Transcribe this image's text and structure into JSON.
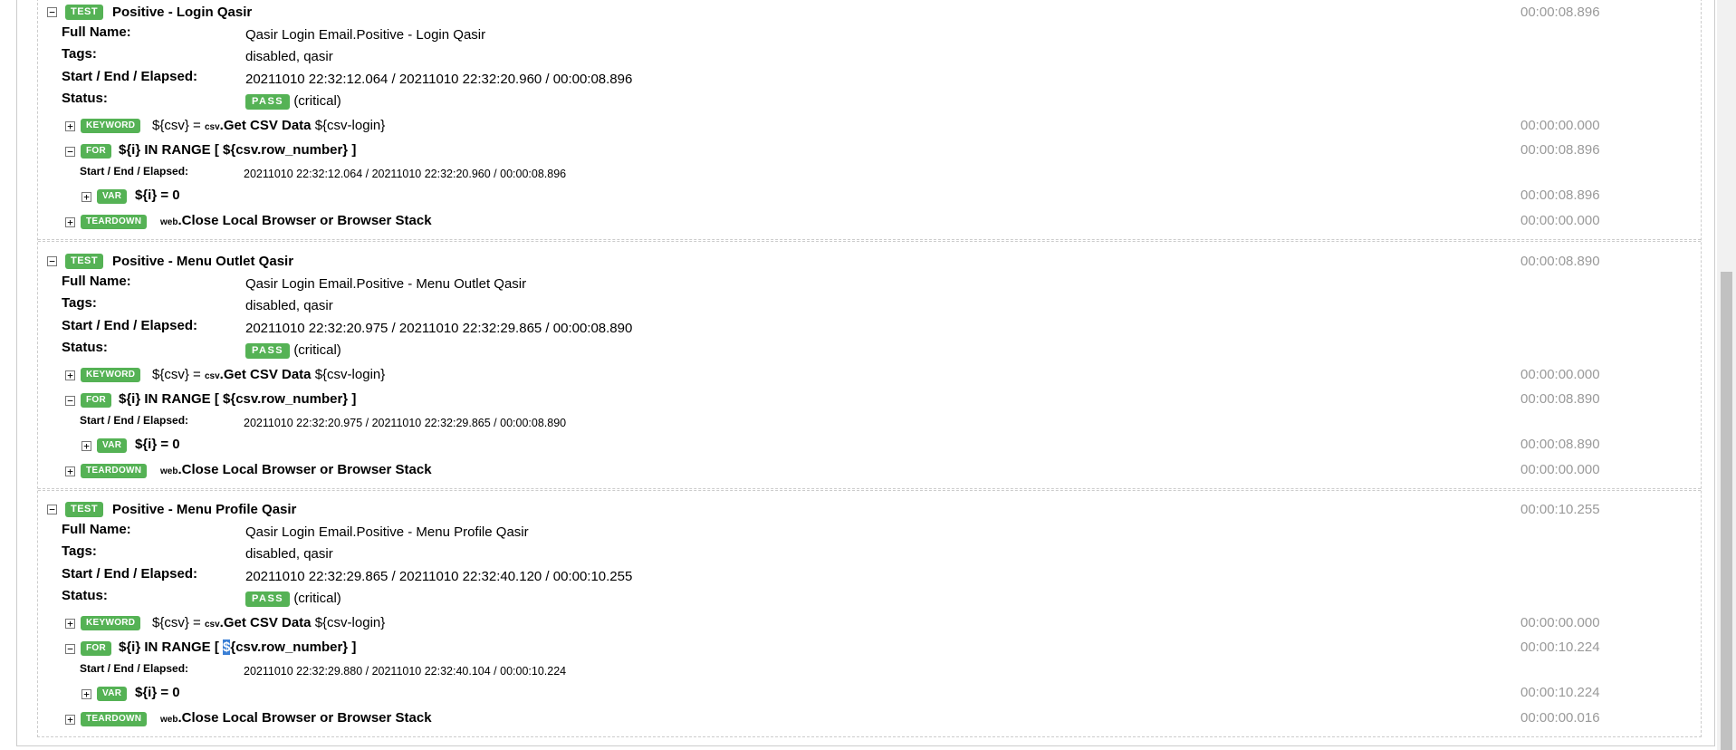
{
  "labels": {
    "test": "TEST",
    "keyword": "KEYWORD",
    "for": "FOR",
    "var": "VAR",
    "teardown": "TEARDOWN",
    "pass": "PASS",
    "critical": "(critical)",
    "full_name": "Full Name:",
    "tags": "Tags:",
    "start_end_elapsed": "Start / End / Elapsed:",
    "status": "Status:",
    "expand": "+",
    "collapse": "−"
  },
  "tests": [
    {
      "name": "Positive - Login Qasir",
      "elapsed": "00:00:08.896",
      "full_name": "Qasir Login Email.Positive - Login Qasir",
      "tags": "disabled, qasir",
      "times": "20211010 22:32:12.064 / 20211010 22:32:20.960 / 00:00:08.896",
      "keyword": {
        "assign": "${csv} = ",
        "lib": "csv",
        "dot": ".",
        "name": "Get CSV Data",
        "args": " ${csv-login}",
        "elapsed": "00:00:00.000"
      },
      "for": {
        "pre": "${i} IN RANGE [ ",
        "var": "${csv.row_number}",
        "post": " ]",
        "elapsed": "00:00:08.896",
        "times": "20211010 22:32:12.064 / 20211010 22:32:20.960 / 00:00:08.896"
      },
      "var": {
        "text": "${i} = 0",
        "elapsed": "00:00:08.896"
      },
      "teardown": {
        "lib": "web",
        "dot": ".",
        "name": "Close Local Browser or Browser Stack",
        "elapsed": "00:00:00.000"
      }
    },
    {
      "name": "Positive - Menu Outlet Qasir",
      "elapsed": "00:00:08.890",
      "full_name": "Qasir Login Email.Positive - Menu Outlet Qasir",
      "tags": "disabled, qasir",
      "times": "20211010 22:32:20.975 / 20211010 22:32:29.865 / 00:00:08.890",
      "keyword": {
        "assign": "${csv} = ",
        "lib": "csv",
        "dot": ".",
        "name": "Get CSV Data",
        "args": " ${csv-login}",
        "elapsed": "00:00:00.000"
      },
      "for": {
        "pre": "${i} IN RANGE [ ",
        "var": "${csv.row_number}",
        "post": " ]",
        "elapsed": "00:00:08.890",
        "times": "20211010 22:32:20.975 / 20211010 22:32:29.865 / 00:00:08.890"
      },
      "var": {
        "text": "${i} = 0",
        "elapsed": "00:00:08.890"
      },
      "teardown": {
        "lib": "web",
        "dot": ".",
        "name": "Close Local Browser or Browser Stack",
        "elapsed": "00:00:00.000"
      }
    },
    {
      "name": "Positive - Menu Profile Qasir",
      "elapsed": "00:00:10.255",
      "full_name": "Qasir Login Email.Positive - Menu Profile Qasir",
      "tags": "disabled, qasir",
      "times": "20211010 22:32:29.865 / 20211010 22:32:40.120 / 00:00:10.255",
      "keyword": {
        "assign": "${csv} = ",
        "lib": "csv",
        "dot": ".",
        "name": "Get CSV Data",
        "args": " ${csv-login}",
        "elapsed": "00:00:00.000"
      },
      "for": {
        "pre": "${i} IN RANGE [ ",
        "var": "${csv.row_number}",
        "post": " ]",
        "elapsed": "00:00:10.224",
        "times": "20211010 22:32:29.880 / 20211010 22:32:40.104 / 00:00:10.224"
      },
      "var": {
        "text": "${i} = 0",
        "elapsed": "00:00:10.224"
      },
      "teardown": {
        "lib": "web",
        "dot": ".",
        "name": "Close Local Browser or Browser Stack",
        "elapsed": "00:00:00.016"
      }
    }
  ]
}
